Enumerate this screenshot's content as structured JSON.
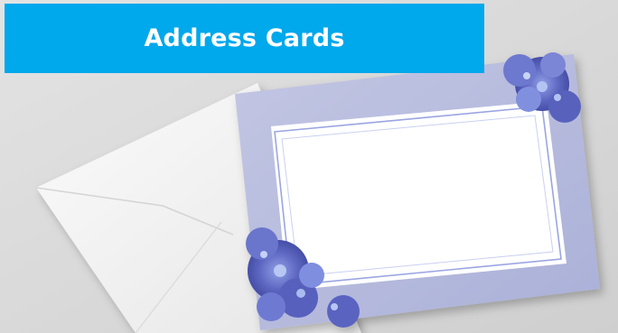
{
  "banner": {
    "title": "Address Cards",
    "color": "#00a8ec"
  },
  "image": {
    "subject": "address-card-with-envelope",
    "colors": {
      "background": "#dcdcdc",
      "envelope": "#f6f6f6",
      "card_border": "#b7bbdc",
      "card_center": "#ffffff",
      "flowers": "#6b74c8"
    }
  }
}
